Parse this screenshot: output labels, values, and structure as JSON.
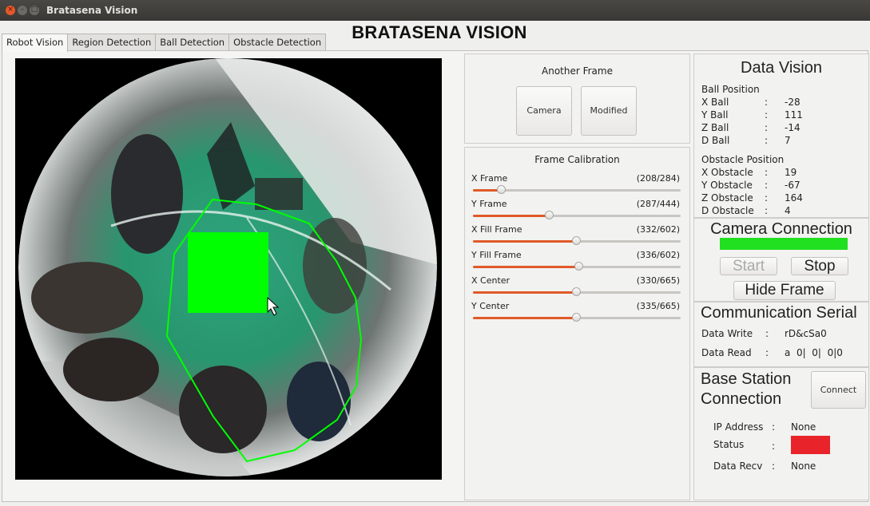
{
  "window": {
    "title": "Bratasena Vision",
    "close_glyph": "×",
    "min_glyph": "–",
    "max_glyph": "□"
  },
  "app": {
    "heading": "BRATASENA VISION"
  },
  "tabs": [
    {
      "label": "Robot Vision",
      "active": true
    },
    {
      "label": "Region Detection",
      "active": false
    },
    {
      "label": "Ball Detection",
      "active": false
    },
    {
      "label": "Obstacle Detection",
      "active": false
    }
  ],
  "another_frame": {
    "title": "Another Frame",
    "camera_label": "Camera",
    "modified_label": "Modified"
  },
  "calibration": {
    "title": "Frame Calibration",
    "sliders": [
      {
        "label": "X Frame",
        "value_text": "(208/284)",
        "fraction": 0.14
      },
      {
        "label": "Y Frame",
        "value_text": "(287/444)",
        "fraction": 0.37
      },
      {
        "label": "X Fill Frame",
        "value_text": "(332/602)",
        "fraction": 0.5
      },
      {
        "label": "Y Fill Frame",
        "value_text": "(336/602)",
        "fraction": 0.51
      },
      {
        "label": "X Center",
        "value_text": "(330/665)",
        "fraction": 0.5
      },
      {
        "label": "Y Center",
        "value_text": "(335/665)",
        "fraction": 0.5
      }
    ],
    "accent_color": "#e05a28"
  },
  "data_vision": {
    "title": "Data Vision",
    "ball_header": "Ball Position",
    "ball": [
      {
        "label": "X Ball",
        "sep": ":",
        "value": "-28"
      },
      {
        "label": "Y Ball",
        "sep": ":",
        "value": "111"
      },
      {
        "label": "Z Ball",
        "sep": ":",
        "value": "-14"
      },
      {
        "label": "D Ball",
        "sep": ":",
        "value": "7"
      }
    ],
    "obstacle_header": "Obstacle Position",
    "obstacle": [
      {
        "label": "X Obstacle",
        "sep": ":",
        "value": "19"
      },
      {
        "label": "Y Obstacle",
        "sep": ":",
        "value": "-67"
      },
      {
        "label": "Z Obstacle",
        "sep": ":",
        "value": "164"
      },
      {
        "label": "D Obstacle",
        "sep": ":",
        "value": "4"
      }
    ]
  },
  "camera_connection": {
    "title": "Camera Connection",
    "status_color": "#20e020",
    "start_label": "Start",
    "stop_label": "Stop",
    "hide_label": "Hide Frame"
  },
  "serial": {
    "title": "Communication Serial",
    "write_label": "Data Write",
    "write_sep": ":",
    "write_value": "rD&cSa0",
    "read_label": "Data Read",
    "read_sep": ":",
    "read_value": "a  0|  0|  0|0"
  },
  "base_station": {
    "title_line1": "Base Station",
    "title_line2": "Connection",
    "connect_label": "Connect",
    "ip_label": "IP Address",
    "ip_sep": ":",
    "ip_value": "None",
    "status_label": "Status",
    "status_sep": ":",
    "status_color": "#e8242a",
    "recv_label": "Data Recv",
    "recv_sep": ":",
    "recv_value": "None"
  },
  "video": {
    "detection_color": "#00ff00"
  }
}
